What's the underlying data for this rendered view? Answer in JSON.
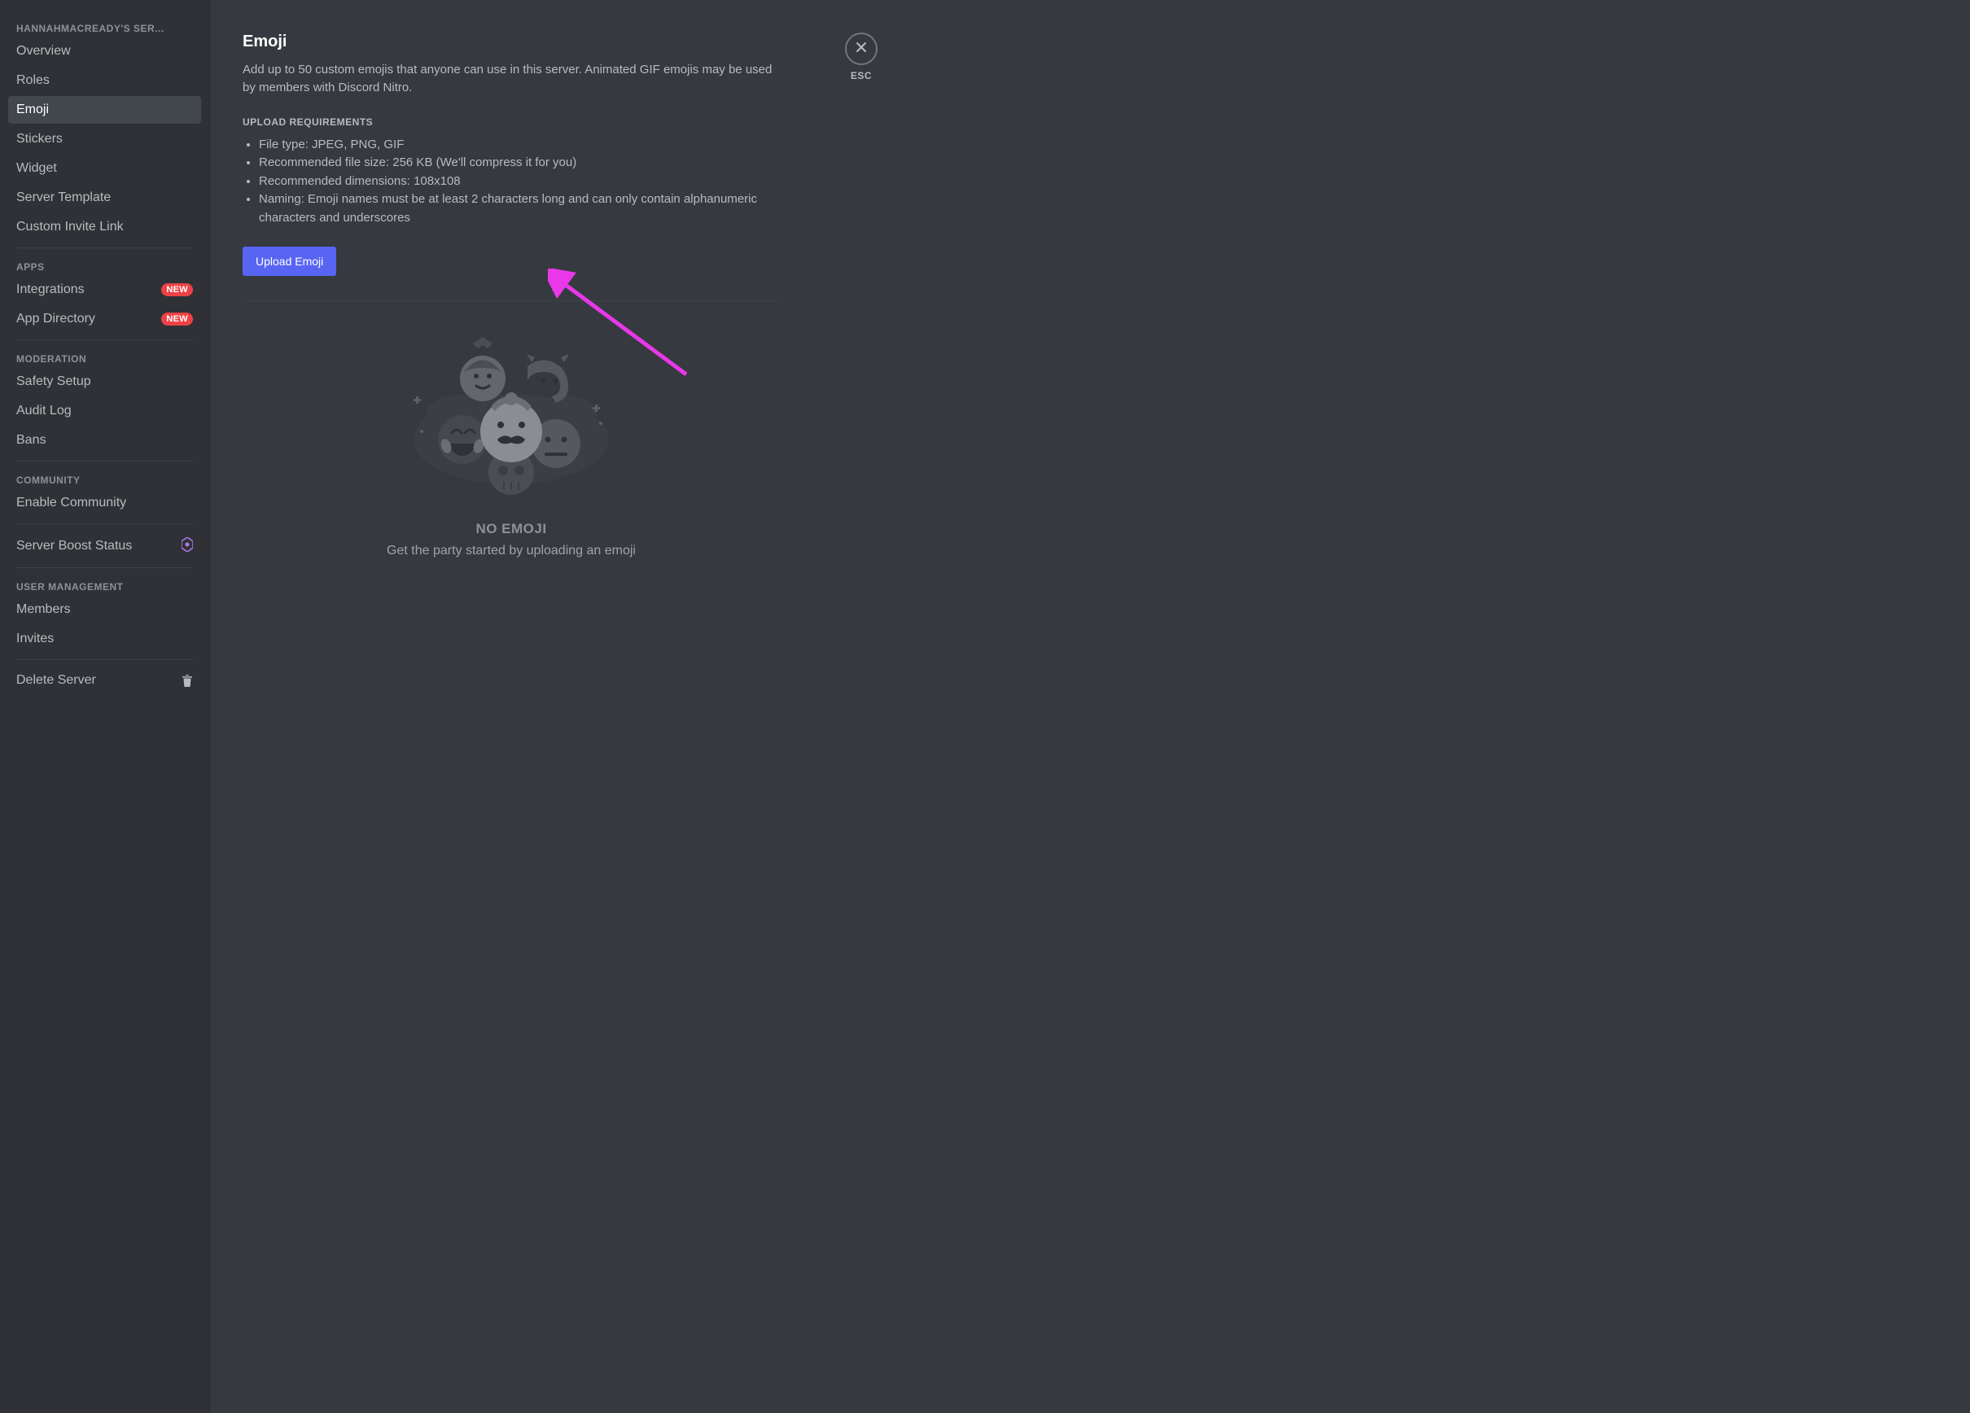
{
  "sidebar": {
    "server_header": "HANNAHMACREADY'S SER...",
    "core": [
      {
        "label": "Overview",
        "id": "overview",
        "active": false
      },
      {
        "label": "Roles",
        "id": "roles",
        "active": false
      },
      {
        "label": "Emoji",
        "id": "emoji",
        "active": true
      },
      {
        "label": "Stickers",
        "id": "stickers",
        "active": false
      },
      {
        "label": "Widget",
        "id": "widget",
        "active": false
      },
      {
        "label": "Server Template",
        "id": "server-template",
        "active": false
      },
      {
        "label": "Custom Invite Link",
        "id": "custom-invite-link",
        "active": false
      }
    ],
    "apps_header": "APPS",
    "apps": [
      {
        "label": "Integrations",
        "id": "integrations",
        "badge": "NEW"
      },
      {
        "label": "App Directory",
        "id": "app-directory",
        "badge": "NEW"
      }
    ],
    "moderation_header": "MODERATION",
    "moderation": [
      {
        "label": "Safety Setup",
        "id": "safety-setup"
      },
      {
        "label": "Audit Log",
        "id": "audit-log"
      },
      {
        "label": "Bans",
        "id": "bans"
      }
    ],
    "community_header": "COMMUNITY",
    "community": [
      {
        "label": "Enable Community",
        "id": "enable-community"
      }
    ],
    "boost": {
      "label": "Server Boost Status",
      "id": "server-boost-status"
    },
    "user_management_header": "USER MANAGEMENT",
    "user_management": [
      {
        "label": "Members",
        "id": "members"
      },
      {
        "label": "Invites",
        "id": "invites"
      }
    ],
    "delete_server": {
      "label": "Delete Server",
      "id": "delete-server"
    }
  },
  "page": {
    "title": "Emoji",
    "description": "Add up to 50 custom emojis that anyone can use in this server. Animated GIF emojis may be used by members with Discord Nitro.",
    "req_header": "UPLOAD REQUIREMENTS",
    "requirements": [
      "File type: JPEG, PNG, GIF",
      "Recommended file size: 256 KB (We'll compress it for you)",
      "Recommended dimensions: 108x108",
      "Naming: Emoji names must be at least 2 characters long and can only contain alphanumeric characters and underscores"
    ],
    "upload_label": "Upload Emoji",
    "empty_title": "NO EMOJI",
    "empty_desc": "Get the party started by uploading an emoji"
  },
  "close": {
    "esc_label": "ESC"
  },
  "annotation": {
    "arrow_color": "#e838e8"
  }
}
